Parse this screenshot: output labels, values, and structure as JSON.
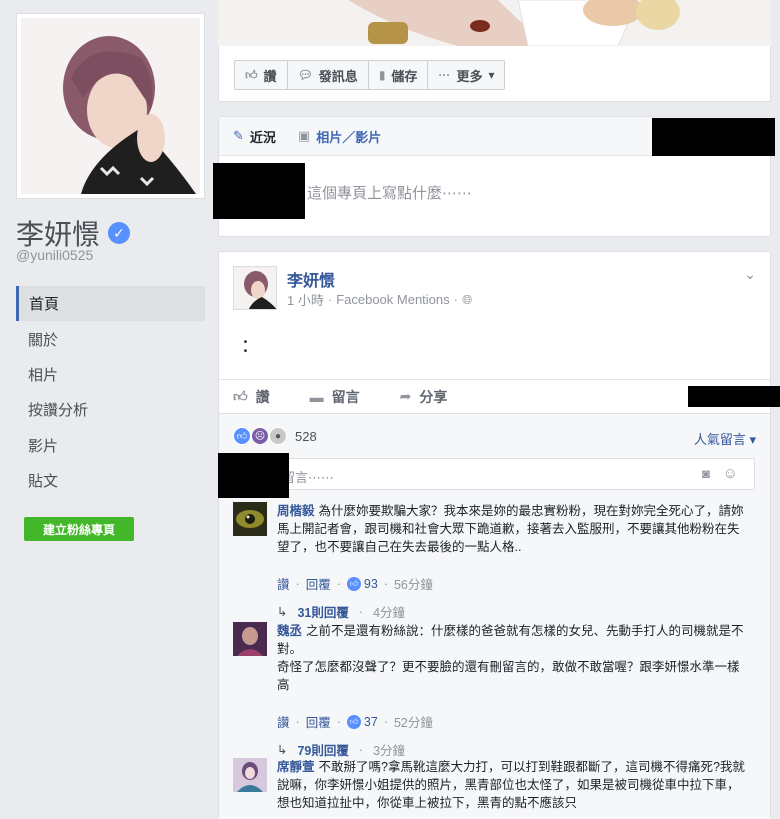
{
  "page": {
    "name": "李妍憬",
    "handle": "@yunili0525",
    "verified_mark": "✓"
  },
  "nav": {
    "items": [
      {
        "label": "首頁",
        "active": true
      },
      {
        "label": "關於"
      },
      {
        "label": "相片"
      },
      {
        "label": "按讚分析"
      },
      {
        "label": "影片"
      },
      {
        "label": "貼文"
      }
    ],
    "create_fan_page": "建立粉絲專頁"
  },
  "toolbar": {
    "like": "讚",
    "message": "發訊息",
    "save": "儲存",
    "more": "更多"
  },
  "composer": {
    "tabs": [
      "近況",
      "相片／影片"
    ],
    "placeholder": "這個專頁上寫點什麼⋯⋯"
  },
  "post": {
    "author": "李妍憬",
    "time": "1 小時",
    "via": "Facebook Mentions",
    "separator": "·",
    "text": "：",
    "actions": {
      "like": "讚",
      "comment": "留言",
      "share": "分享"
    },
    "reaction_count": "528",
    "sort_label": "人氣留言",
    "comment_placeholder": "留言⋯⋯"
  },
  "comments": [
    {
      "name": "周楷毅",
      "text": "為什麼妳要欺騙大家？我本來是妳的最忠實粉粉，現在對妳完全死心了，請妳馬上開記者會，跟司機和社會大眾下跪道歉，接著去入監服刑，不要讓其他粉粉在失望了，也不要讓自己在失去最後的一點人格..",
      "like": "讚",
      "reply": "回覆",
      "likes": "93",
      "time": "56分鐘",
      "replies_label": "31則回覆",
      "replies_time": "4分鐘"
    },
    {
      "name": "魏丞",
      "text": "之前不是還有粉絲說：什麼樣的爸爸就有怎樣的女兒、先動手打人的司機就是不對。",
      "text2": "奇怪了怎麼都沒聲了？更不要臉的還有刪留言的，敢做不敢當喔？跟李妍憬水準一樣高",
      "like": "讚",
      "reply": "回覆",
      "likes": "37",
      "time": "52分鐘",
      "replies_label": "79則回覆",
      "replies_time": "3分鐘"
    },
    {
      "name": "席靜萱",
      "text": "不敢掰了嗎?拿馬靴這麼大力打，可以打到鞋跟都斷了，這司機不得痛死?我就說嘛，你李妍憬小姐提供的照片，黑青部位也太怪了，如果是被司機從車中拉下車，想也知道拉扯中，你從車上被拉下，黑青的點不應該只"
    }
  ]
}
